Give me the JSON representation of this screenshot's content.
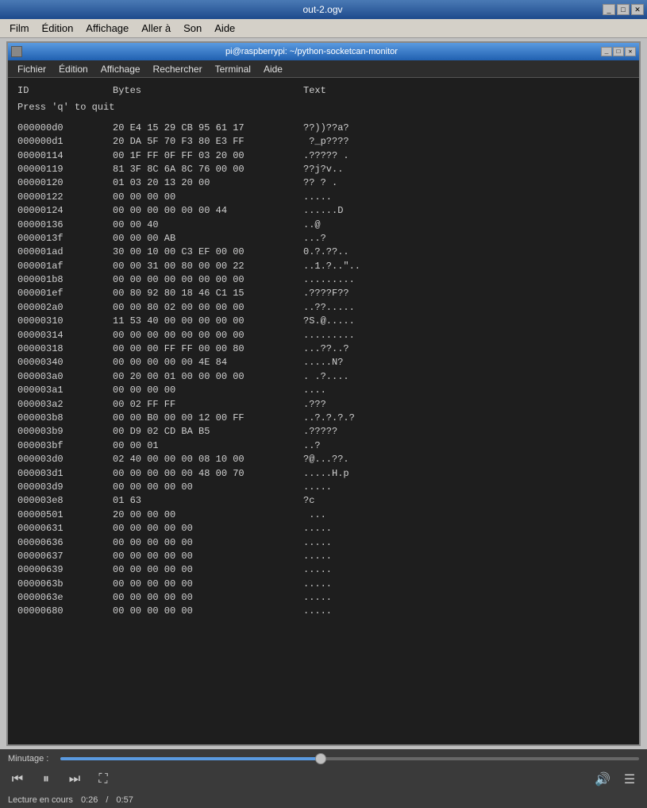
{
  "outer_window": {
    "title": "out-2.ogv",
    "controls": [
      "_",
      "□",
      "✕"
    ]
  },
  "outer_menu": {
    "items": [
      "Film",
      "Édition",
      "Affichage",
      "Aller à",
      "Son",
      "Aide"
    ]
  },
  "inner_window": {
    "title": "pi@raspberrypi: ~/python-socketcan-monitor",
    "controls": [
      "_",
      "□",
      "✕"
    ]
  },
  "inner_menu": {
    "items": [
      "Fichier",
      "Édition",
      "Affichage",
      "Rechercher",
      "Terminal",
      "Aide"
    ]
  },
  "terminal": {
    "headers": {
      "id": "ID",
      "bytes": "Bytes",
      "text": "Text"
    },
    "quit_line": "Press 'q' to quit",
    "rows": [
      {
        "id": "000000d0",
        "bytes": "20 E4 15 29 CB 95 61 17",
        "text": "??))??a?"
      },
      {
        "id": "000000d1",
        "bytes": "20 DA 5F 70 F3 80 E3 FF",
        "text": " ?_p????"
      },
      {
        "id": "00000114",
        "bytes": "00 1F FF 0F FF 03 20 00",
        "text": ".????? ."
      },
      {
        "id": "00000119",
        "bytes": "81 3F 8C 6A 8C 76 00 00",
        "text": "??j?v.."
      },
      {
        "id": "00000120",
        "bytes": "01 03 20 13 20 00",
        "text": "?? ? ."
      },
      {
        "id": "00000122",
        "bytes": "00 00 00 00",
        "text": "....."
      },
      {
        "id": "00000124",
        "bytes": "00 00 00 00 00 00 44",
        "text": "......D"
      },
      {
        "id": "00000136",
        "bytes": "00 00 40",
        "text": "..@"
      },
      {
        "id": "0000013f",
        "bytes": "00 00 00 AB",
        "text": "...?"
      },
      {
        "id": "000001ad",
        "bytes": "30 00 10 00 C3 EF 00 00",
        "text": "0.?.??.. "
      },
      {
        "id": "000001af",
        "bytes": "00 00 31 00 80 00 00 22",
        "text": "..1.?..\".."
      },
      {
        "id": "000001b8",
        "bytes": "00 00 00 00 00 00 00 00",
        "text": "........."
      },
      {
        "id": "000001ef",
        "bytes": "00 80 92 80 18 46 C1 15",
        "text": ".????F??"
      },
      {
        "id": "000002a0",
        "bytes": "00 00 80 02 00 00 00 00",
        "text": "..??....."
      },
      {
        "id": "00000310",
        "bytes": "11 53 40 00 00 00 00 00",
        "text": "?S.@....."
      },
      {
        "id": "00000314",
        "bytes": "00 00 00 00 00 00 00 00",
        "text": "........."
      },
      {
        "id": "00000318",
        "bytes": "00 00 00 FF FF 00 00 80",
        "text": "...??..?"
      },
      {
        "id": "00000340",
        "bytes": "00 00 00 00 00 4E 84",
        "text": ".....N?"
      },
      {
        "id": "000003a0",
        "bytes": "00 20 00 01 00 00 00 00",
        "text": ". .?...."
      },
      {
        "id": "000003a1",
        "bytes": "00 00 00 00",
        "text": "...."
      },
      {
        "id": "000003a2",
        "bytes": "00 02 FF FF",
        "text": ".???"
      },
      {
        "id": "000003b8",
        "bytes": "00 00 B0 00 00 12 00 FF",
        "text": "..?.?.?.?"
      },
      {
        "id": "000003b9",
        "bytes": "00 D9 02 CD BA B5",
        "text": ".?????"
      },
      {
        "id": "000003bf",
        "bytes": "00 00 01",
        "text": "..?"
      },
      {
        "id": "000003d0",
        "bytes": "02 40 00 00 00 08 10 00",
        "text": "?@...??."
      },
      {
        "id": "000003d1",
        "bytes": "00 00 00 00 00 48 00 70",
        "text": ".....H.p"
      },
      {
        "id": "000003d9",
        "bytes": "00 00 00 00 00",
        "text": "....."
      },
      {
        "id": "000003e8",
        "bytes": "01 63",
        "text": "?c"
      },
      {
        "id": "00000501",
        "bytes": "20 00 00 00",
        "text": " ..."
      },
      {
        "id": "00000631",
        "bytes": "00 00 00 00 00",
        "text": "....."
      },
      {
        "id": "00000636",
        "bytes": "00 00 00 00 00",
        "text": "....."
      },
      {
        "id": "00000637",
        "bytes": "00 00 00 00 00",
        "text": "....."
      },
      {
        "id": "00000639",
        "bytes": "00 00 00 00 00",
        "text": "....."
      },
      {
        "id": "0000063b",
        "bytes": "00 00 00 00 00",
        "text": "....."
      },
      {
        "id": "0000063e",
        "bytes": "00 00 00 00 00",
        "text": "....."
      },
      {
        "id": "00000680",
        "bytes": "00 00 00 00 00",
        "text": "....."
      }
    ]
  },
  "player": {
    "progress_label": "Minutage :",
    "progress_percent": 45,
    "controls": {
      "prev": "⏮",
      "play_pause": "⏸",
      "next": "⏭",
      "fullscreen": "⛶",
      "volume": "🔊",
      "menu": "☰"
    },
    "status": "Lecture en cours",
    "time_current": "0:26",
    "time_total": "0:57"
  }
}
